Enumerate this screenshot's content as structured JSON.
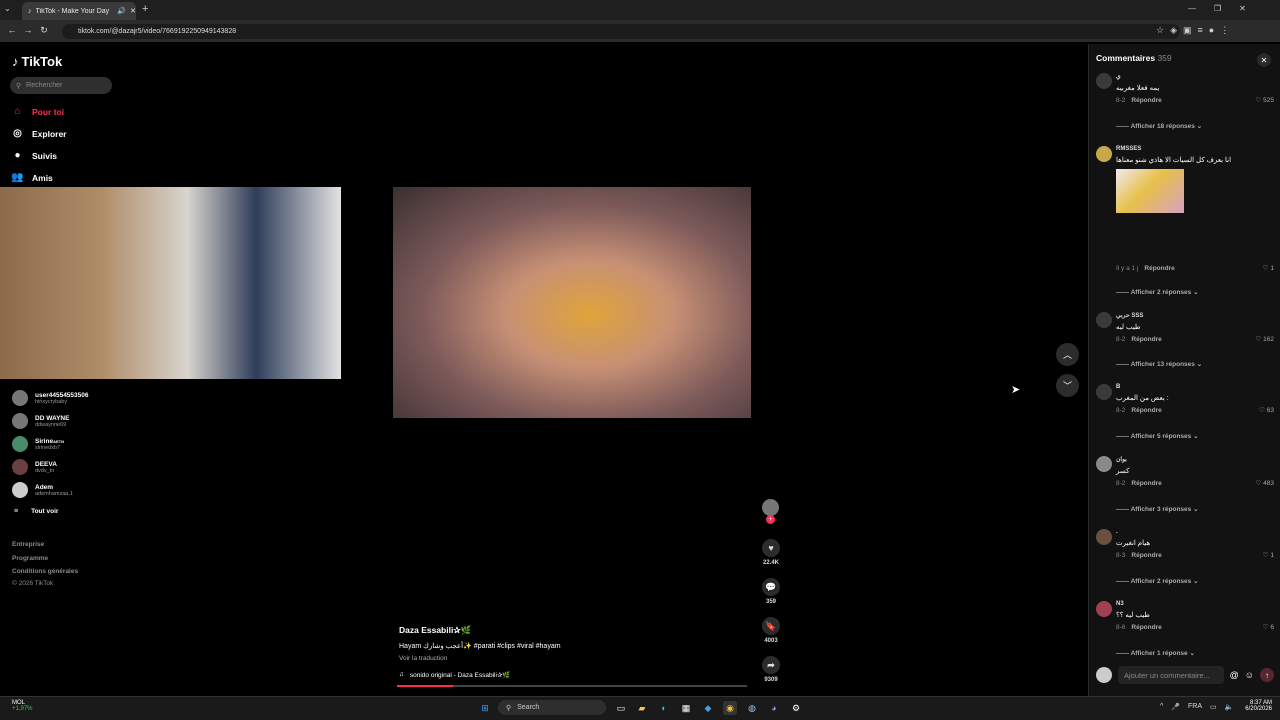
{
  "browser": {
    "tab_title": "TikTok - Make Your Day",
    "url": "tiktok.com/@dazajr5/video/7669192250949143828"
  },
  "tiktok": {
    "logo": "TikTok",
    "search_placeholder": "Rechercher",
    "nav": [
      "Pour toi",
      "Explorer",
      "Suivis",
      "Amis"
    ],
    "following": [
      {
        "name": "user44554553506",
        "user": "hinxycrybaby"
      },
      {
        "name": "DD WAYNE",
        "user": "ddwaynne69"
      },
      {
        "name": "Sirine",
        "badge": "AETN",
        "user": "sirinedxb7"
      },
      {
        "name": "DEEVA",
        "user": "dvdv_tn"
      },
      {
        "name": "Adem",
        "user": "ademhamzaa.1"
      }
    ],
    "see_all": "Tout voir",
    "footer": [
      "Entreprise",
      "Programme",
      "Conditions générales",
      "© 2026 TikTok"
    ],
    "video": {
      "author": "Daza Essabili✰🌿",
      "caption": "Hayam أعجب وشارك✨ #parati #clips #viral #hayam",
      "translate": "Voir la traduction",
      "sound": "sonido original - Daza Essabili✰🌿",
      "progress_fraction": 0.16
    },
    "actions": {
      "likes": "22.4K",
      "comments": "359",
      "saves": "4003",
      "shares": "9309"
    }
  },
  "comments_panel": {
    "title": "Commentaires",
    "count": "359",
    "input_placeholder": "Ajouter un commentaire...",
    "items": [
      {
        "user": "ي",
        "text": "يمه فعلا مغربيه",
        "date": "8-2",
        "reply": "Répondre",
        "likes": "525",
        "more": "Afficher 18 réponses"
      },
      {
        "user": "RMSSES",
        "text": "انا بعرف كل السيات الا هاذي شنو معناها",
        "date": "Il y a 1 j",
        "reply": "Répondre",
        "likes": "1",
        "more": "Afficher 2 réponses"
      },
      {
        "user": "حربي SSS",
        "text": "طيب ليه",
        "date": "8-2",
        "reply": "Répondre",
        "likes": "162",
        "more": "Afficher 13 réponses"
      },
      {
        "user": "B",
        "text": "بعض من المغرب :",
        "date": "8-2",
        "reply": "Répondre",
        "likes": "63",
        "more": "Afficher 5 réponses"
      },
      {
        "user": "بوان",
        "text": "كسر",
        "date": "8-2",
        "reply": "Répondre",
        "likes": "483",
        "more": "Afficher 3 réponses"
      },
      {
        "user": ".",
        "text": "هيام انغيرت",
        "date": "8-3",
        "reply": "Répondre",
        "likes": "1",
        "more": "Afficher 2 réponses"
      },
      {
        "user": "N3",
        "text": "طيب ليه ؟؟",
        "date": "8-6",
        "reply": "Répondre",
        "likes": "6",
        "more": "Afficher 1 réponse"
      }
    ]
  },
  "taskbar": {
    "weather_name": "MOL",
    "weather_change": "+1,97%",
    "search": "Search",
    "lang": "FRA",
    "time": "8:37 AM",
    "date": "6/20/2026"
  },
  "colors": {
    "accent": "#fe2c55"
  }
}
